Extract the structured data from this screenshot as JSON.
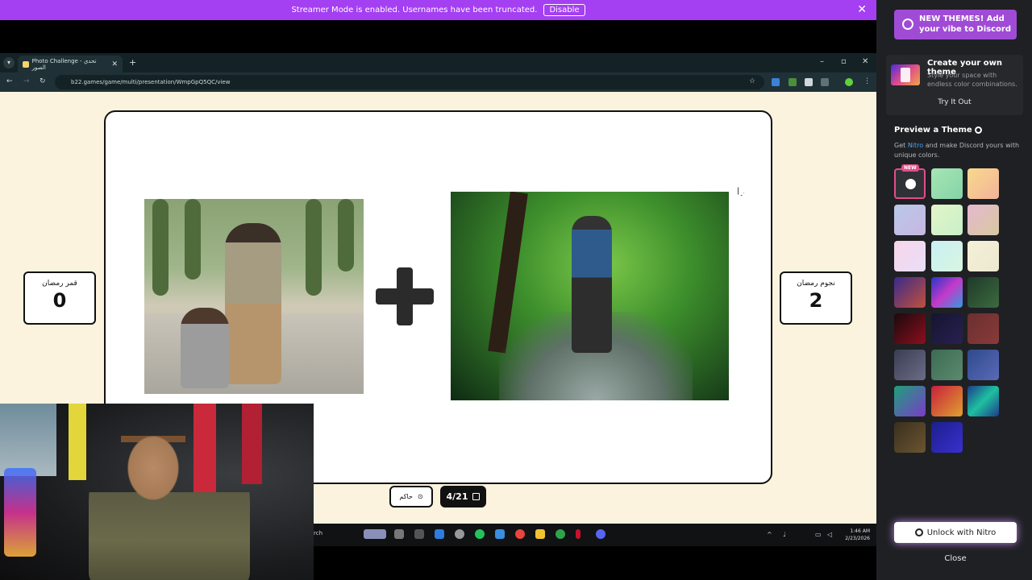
{
  "streamer_banner": {
    "message": "Streamer Mode is enabled. Usernames have been truncated.",
    "disable_label": "Disable"
  },
  "browser": {
    "tab_title": "Photo Challenge - تحدي الصور",
    "url": "b22.games/game/multi/presentation/WmpGpQ5QC/view"
  },
  "game": {
    "left_team": {
      "name": "قمر رمضان",
      "score": "0"
    },
    "right_team": {
      "name": "نجوم رمضان",
      "score": "2"
    },
    "judge_label": "حاكم",
    "counter": "4/21"
  },
  "taskbar": {
    "search_text": "rch",
    "time": "1:46 AM",
    "date": "2/23/2026"
  },
  "discord_panel": {
    "promo_text": "NEW THEMES! Add your vibe to Discord",
    "create_title": "Create your own theme",
    "create_desc": "Style your space with endless color combinations.",
    "try_label": "Try It Out",
    "preview_title": "Preview a Theme",
    "preview_desc_prefix": "Get ",
    "preview_desc_link": "Nitro",
    "preview_desc_suffix": " and make Discord yours with unique colors.",
    "new_tag": "NEW",
    "unlock_label": "Unlock with Nitro",
    "close_label": "Close",
    "swatches": [
      "linear-gradient(135deg,#a6e6b4,#86d3a8)",
      "linear-gradient(135deg,#f8d98c,#f3b39a)",
      "linear-gradient(135deg,#b9c8e8,#c8b6e3)",
      "linear-gradient(135deg,#e3f5c8,#c8f0c8)",
      "linear-gradient(135deg,#e6b8cf,#d8c8a0)",
      "linear-gradient(135deg,#f7d6ea,#e8def8)",
      "linear-gradient(135deg,#c8f0f5,#d8f5e0)",
      "linear-gradient(135deg,#f5f0d8,#ece8d0)",
      "linear-gradient(135deg,#3a2b8c,#c2503a)",
      "linear-gradient(135deg,#2636c8,#c43ac8,#2f9be0)",
      "linear-gradient(135deg,#1f3a2a,#3c6a3e)",
      "linear-gradient(135deg,#1a0a0e,#8c0f1d)",
      "linear-gradient(135deg,#131530,#2a2050)",
      "linear-gradient(135deg,#6a2f2f,#8a3a3a)",
      "linear-gradient(135deg,#3a3d52,#6a6d86)",
      "linear-gradient(135deg,#3b6b54,#5c8a6e)",
      "linear-gradient(135deg,#2e4a8c,#5a6ab8)",
      "linear-gradient(135deg,#1ea07a,#7b3bc8)",
      "linear-gradient(135deg,#c8203c,#e0a030)",
      "linear-gradient(135deg,#1f3a8c,#1ec0a0,#1f3a8c)",
      "linear-gradient(135deg,#3a2f1f,#6b5530)",
      "linear-gradient(135deg,#1c1f8c,#3a2fd0)"
    ]
  }
}
